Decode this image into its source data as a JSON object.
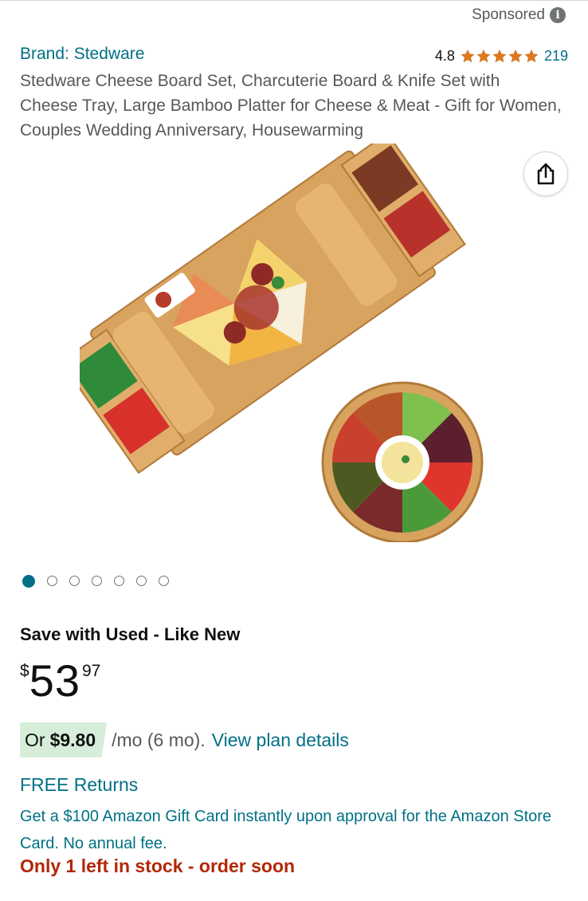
{
  "sponsored": {
    "label": "Sponsored",
    "icon": "info-icon"
  },
  "product": {
    "brand": "Brand: Stedware",
    "rating": "4.8",
    "rating_stars": 5,
    "review_count": "219",
    "title": "Stedware Cheese Board Set, Charcuterie Board & Knife Set with Cheese Tray, Large Bamboo Platter for Cheese & Meat - Gift for Women, Couples Wedding Anniversary, Housewarming"
  },
  "gallery": {
    "total_images": 7,
    "active_index": 0
  },
  "buying": {
    "save_heading": "Save with Used - Like New",
    "price_symbol": "$",
    "price_whole": "53",
    "price_fraction": "97",
    "installment_prefix": "Or",
    "installment_amount": "$9.80",
    "installment_suffix": "/mo (6 mo).",
    "installment_link": "View plan details",
    "free_returns": "FREE Returns",
    "gift_card_offer": "Get a $100 Amazon Gift Card instantly upon approval for the Amazon Store Card. No annual fee.",
    "stock_warning": "Only 1 left in stock - order soon"
  },
  "colors": {
    "link": "#007185",
    "star": "#de7921",
    "stock": "#b12704",
    "installment_bg": "#d6eed9"
  }
}
